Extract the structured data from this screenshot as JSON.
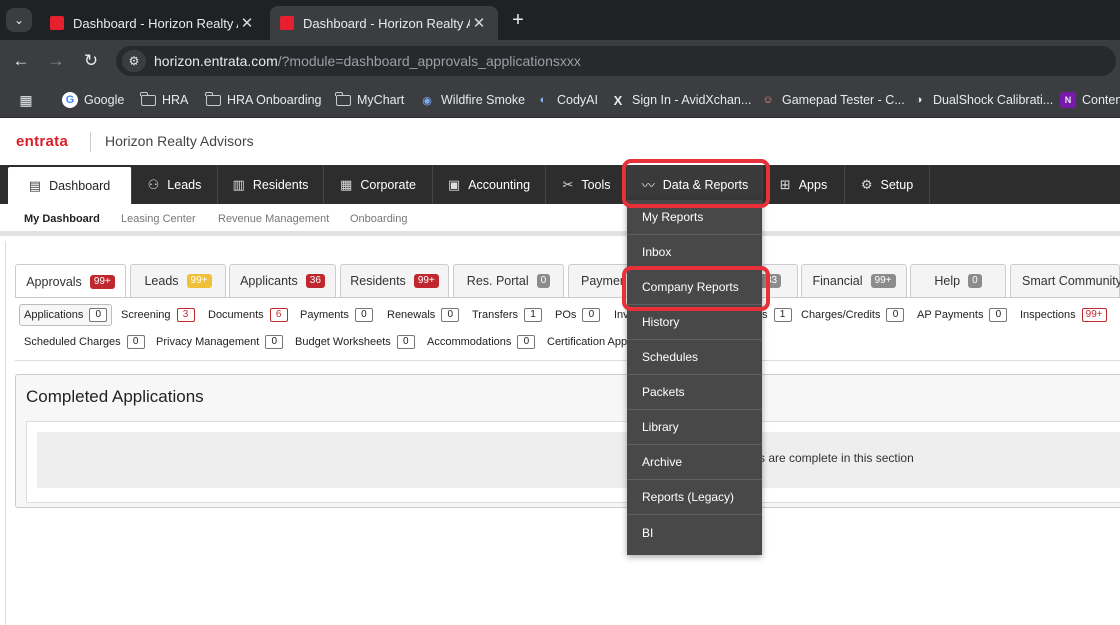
{
  "browser": {
    "tabs": [
      {
        "title": "Dashboard - Horizon Realty Adv",
        "close": "✕"
      },
      {
        "title": "Dashboard - Horizon Realty Adv",
        "close": "✕"
      }
    ],
    "new_tab": "+",
    "url_host": "horizon.entrata.com",
    "url_path": "/?module=dashboard_approvals_applicationsxxx",
    "bookmarks": [
      "Google",
      "HRA",
      "HRA Onboarding",
      "MyChart",
      "Wildfire Smoke",
      "CodyAI",
      "Sign In - AvidXchan...",
      "Gamepad Tester - C...",
      "DualShock Calibrati...",
      "Conten"
    ]
  },
  "app": {
    "logo": "entrata",
    "company": "Horizon Realty Advisors",
    "main_nav": [
      "Dashboard",
      "Leads",
      "Residents",
      "Corporate",
      "Accounting",
      "Tools",
      "Data & Reports",
      "Apps",
      "Setup"
    ],
    "sub_nav": [
      "My Dashboard",
      "Leasing Center",
      "Revenue Management",
      "Onboarding"
    ]
  },
  "content_tabs": [
    {
      "label": "Approvals",
      "badge": "99+"
    },
    {
      "label": "Leads",
      "badge": "99+"
    },
    {
      "label": "Applicants",
      "badge": "36"
    },
    {
      "label": "Residents",
      "badge": "99+"
    },
    {
      "label": "Res. Portal",
      "badge": "0"
    },
    {
      "label": "Paymen",
      "badge": ""
    },
    {
      "label": "",
      "badge": "83"
    },
    {
      "label": "Financial",
      "badge": "99+"
    },
    {
      "label": "Help",
      "badge": "0"
    },
    {
      "label": "Smart Community",
      "badge": ""
    }
  ],
  "filters_row1": [
    {
      "label": "Applications",
      "count": "0"
    },
    {
      "label": "Screening",
      "count": "3"
    },
    {
      "label": "Documents",
      "count": "6"
    },
    {
      "label": "Payments",
      "count": "0"
    },
    {
      "label": "Renewals",
      "count": "0"
    },
    {
      "label": "Transfers",
      "count": "1"
    },
    {
      "label": "POs",
      "count": "0"
    },
    {
      "label": "Inv",
      "count": ""
    },
    {
      "label": "s",
      "count": "1"
    },
    {
      "label": "Charges/Credits",
      "count": "0"
    },
    {
      "label": "AP Payments",
      "count": "0"
    },
    {
      "label": "Inspections",
      "count": "99+"
    }
  ],
  "filters_row2": [
    {
      "label": "Scheduled Charges",
      "count": "0"
    },
    {
      "label": "Privacy Management",
      "count": "0"
    },
    {
      "label": "Budget Worksheets",
      "count": "0"
    },
    {
      "label": "Accommodations",
      "count": "0"
    },
    {
      "label": "Certification Appr",
      "count": ""
    }
  ],
  "panel": {
    "title": "Completed Applications",
    "message": "s are complete in this section"
  },
  "dropdown": [
    "My Reports",
    "Inbox",
    "Company Reports",
    "History",
    "Schedules",
    "Packets",
    "Library",
    "Archive",
    "Reports (Legacy)",
    "BI"
  ],
  "colors": {
    "brand": "#d8202a",
    "highlight": "#e8303a",
    "nav_bg": "#2d2d2d",
    "dropdown_bg": "#484848"
  }
}
